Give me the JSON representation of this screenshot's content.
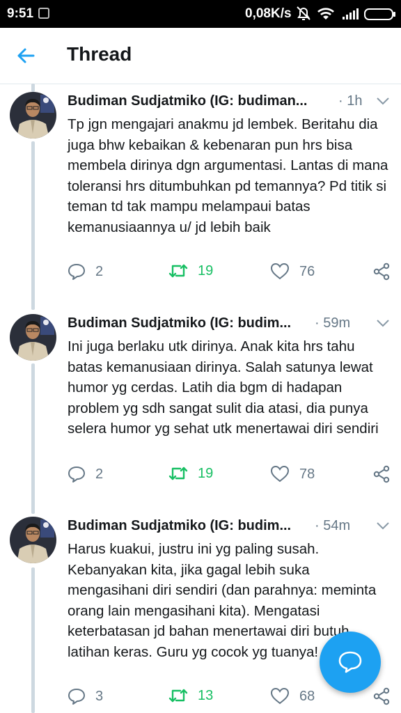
{
  "status_bar": {
    "time": "9:51",
    "network_speed": "0,08K/s",
    "icons": [
      "app-notification-icon",
      "mute-icon",
      "wifi-icon",
      "signal-icon",
      "battery-icon"
    ]
  },
  "header": {
    "title": "Thread"
  },
  "tweets": [
    {
      "author": "Budiman Sudjatmiko (IG: budiman...",
      "time": "· 1h",
      "text": "Tp jgn mengajari anakmu jd lembek. Beritahu dia juga bhw kebaikan & kebenaran pun hrs bisa membela dirinya dgn argumentasi. Lantas di mana toleransi hrs ditumbuhkan pd temannya? Pd titik si teman td tak mampu melampaui batas kemanusiaannya u/ jd lebih baik",
      "replies": "2",
      "retweets": "19",
      "likes": "76"
    },
    {
      "author": "Budiman Sudjatmiko (IG: budim...",
      "time": "· 59m",
      "text": "Ini juga berlaku utk dirinya. Anak kita hrs tahu batas kemanusiaan dirinya. Salah satunya lewat humor yg cerdas. Latih dia bgm di hadapan problem yg sdh sangat sulit dia atasi, dia punya selera humor yg sehat utk menertawai diri sendiri",
      "replies": "2",
      "retweets": "19",
      "likes": "78"
    },
    {
      "author": "Budiman Sudjatmiko (IG: budim...",
      "time": "· 54m",
      "text": "Harus kuakui, justru ini yg paling susah. Kebanyakan kita, jika gagal lebih suka mengasihani diri sendiri (dan parahnya: meminta orang lain mengasihani kita). Mengatasi keterbatasan jd bahan menertawai diri butuh latihan keras. Guru yg cocok yg tuanya!",
      "replies": "3",
      "retweets": "13",
      "likes": "68"
    }
  ],
  "colors": {
    "accent": "#1da1f2",
    "retweet": "#17bf63",
    "muted": "#657786",
    "text": "#14171a"
  },
  "fab": {
    "icon": "compose-reply-icon"
  }
}
